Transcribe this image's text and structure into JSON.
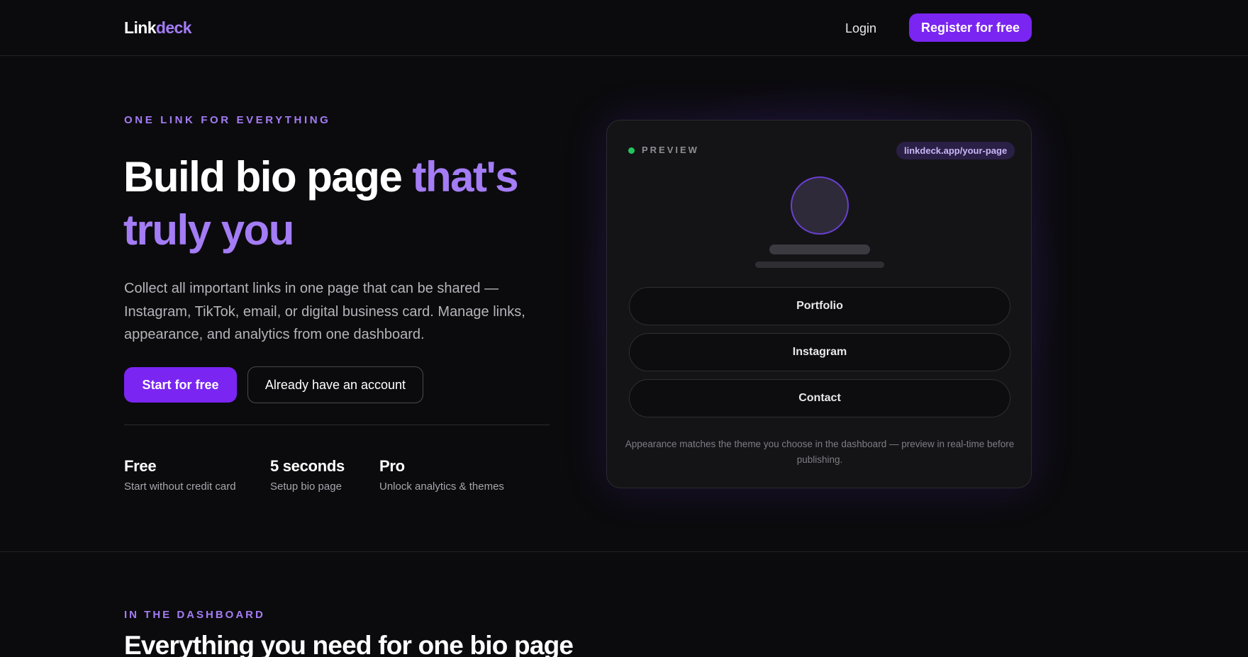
{
  "header": {
    "logo_part1": "Link",
    "logo_part2": "deck",
    "login_label": "Login",
    "register_label": "Register for free"
  },
  "hero": {
    "eyebrow": "ONE LINK FOR EVERYTHING",
    "headline_white": "Build bio page ",
    "headline_accent": "that's truly you",
    "description": "Collect all important links in one page that can be shared — Instagram, TikTok, email, or digital business card. Manage links, appearance, and analytics from one dashboard.",
    "primary_cta": "Start for free",
    "secondary_cta": "Already have an account",
    "stats": [
      {
        "value": "Free",
        "label": "Start without credit card"
      },
      {
        "value": "5 seconds",
        "label": "Setup bio page"
      },
      {
        "value": "Pro",
        "label": "Unlock analytics & themes"
      }
    ]
  },
  "preview": {
    "label": "PREVIEW",
    "url": "linkdeck.app/your-page",
    "links": [
      "Portfolio",
      "Instagram",
      "Contact"
    ],
    "note": "Appearance matches the theme you choose in the dashboard — preview in real-time before publishing."
  },
  "dashboard_section": {
    "eyebrow": "IN THE DASHBOARD",
    "headline": "Everything you need for one bio page"
  },
  "colors": {
    "background": "#0b0b0d",
    "accent": "#7a25f2",
    "accent_text": "#a47cf5",
    "status_dot": "#22c55e"
  }
}
